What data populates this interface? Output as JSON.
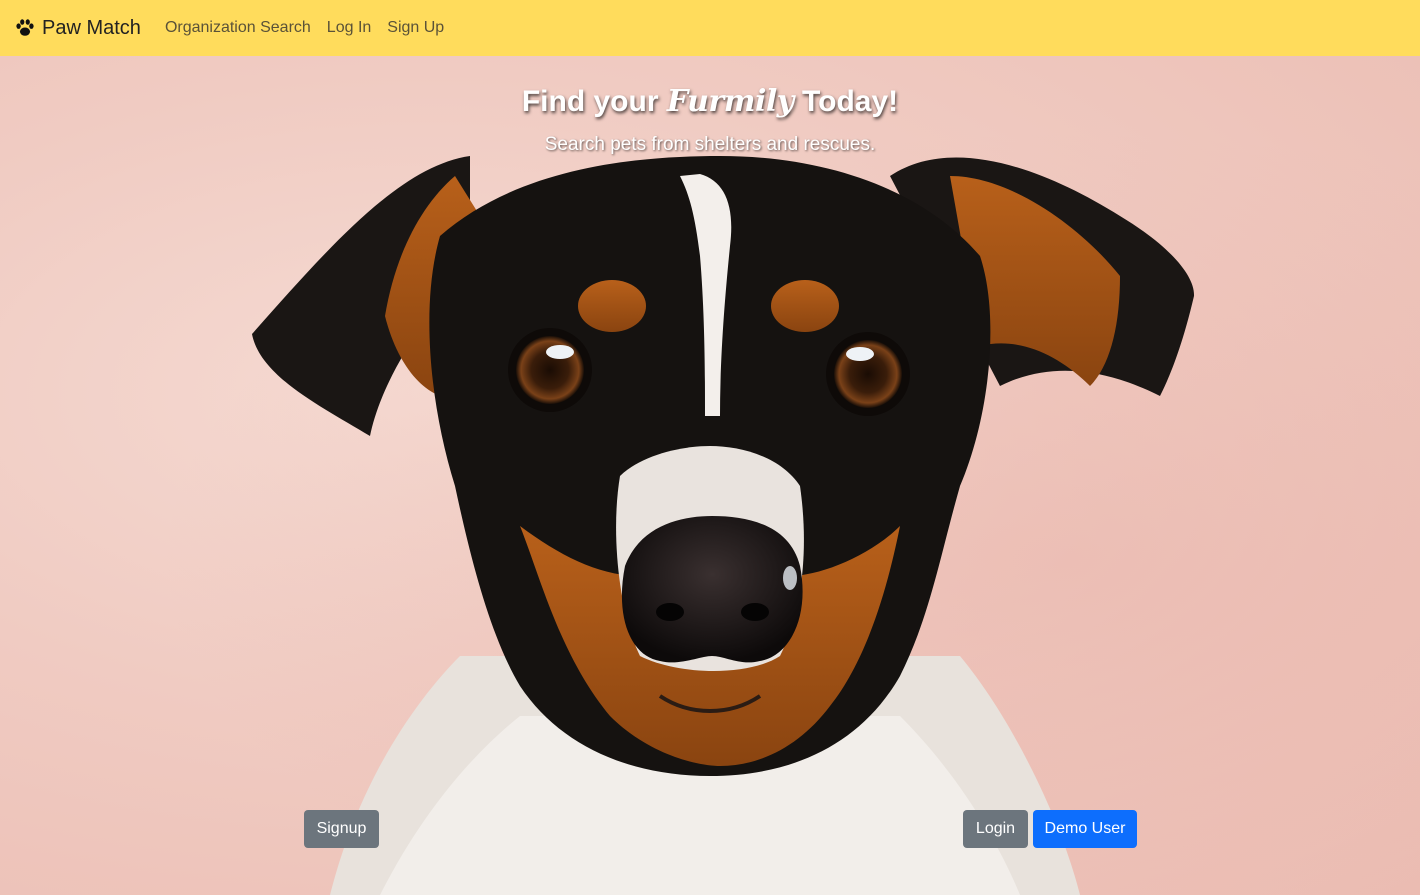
{
  "nav": {
    "brand": "Paw Match",
    "links": [
      "Organization Search",
      "Log In",
      "Sign Up"
    ]
  },
  "hero": {
    "headline_pre": "Find your ",
    "headline_script": "Furmily",
    "headline_post": " Today!",
    "subheadline": "Search pets from shelters and rescues."
  },
  "buttons": {
    "signup": "Signup",
    "login": "Login",
    "demo": "Demo User"
  },
  "colors": {
    "navbar": "#ffdc5c",
    "secondary": "#6c757d",
    "primary": "#0d6efd"
  },
  "icons": {
    "brand": "paw-icon"
  }
}
